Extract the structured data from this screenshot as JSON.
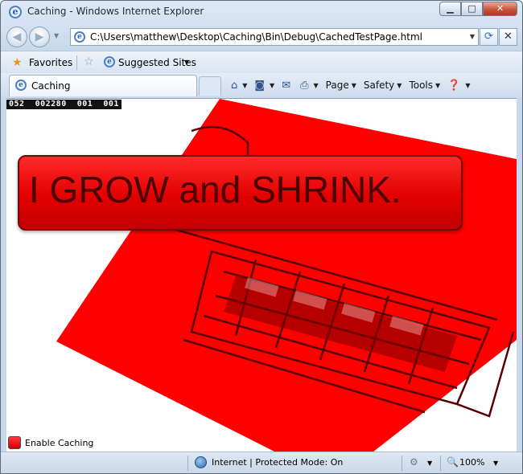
{
  "window": {
    "title": "Caching - Windows Internet Explorer",
    "minimize": "▁",
    "maximize": "□",
    "close": "✕"
  },
  "address": {
    "url": "C:\\Users\\matthew\\Desktop\\Caching\\Bin\\Debug\\CachedTestPage.html",
    "back_glyph": "◀",
    "forward_glyph": "▶",
    "refresh_glyph": "⟳",
    "stop_glyph": "✕"
  },
  "favorites": {
    "favorites_label": "Favorites",
    "suggested_label": "Suggested Sites"
  },
  "tab": {
    "label": "Caching"
  },
  "commands": {
    "page_label": "Page",
    "safety_label": "Safety",
    "tools_label": "Tools"
  },
  "content": {
    "fps_counter": "052  002280  001  001",
    "banner_text": "I GROW and SHRINK.",
    "checkbox_label": "Enable Caching",
    "accent_red": "#ff0000"
  },
  "status": {
    "zone_text": "Internet | Protected Mode: On",
    "zoom": "100%"
  },
  "icons": [
    "ie-logo-icon",
    "back-icon",
    "forward-icon",
    "refresh-icon",
    "stop-icon",
    "favorites-star-icon",
    "add-favorite-icon",
    "home-icon",
    "feeds-icon",
    "mail-icon",
    "print-icon",
    "help-icon",
    "globe-icon",
    "zoom-icon"
  ]
}
